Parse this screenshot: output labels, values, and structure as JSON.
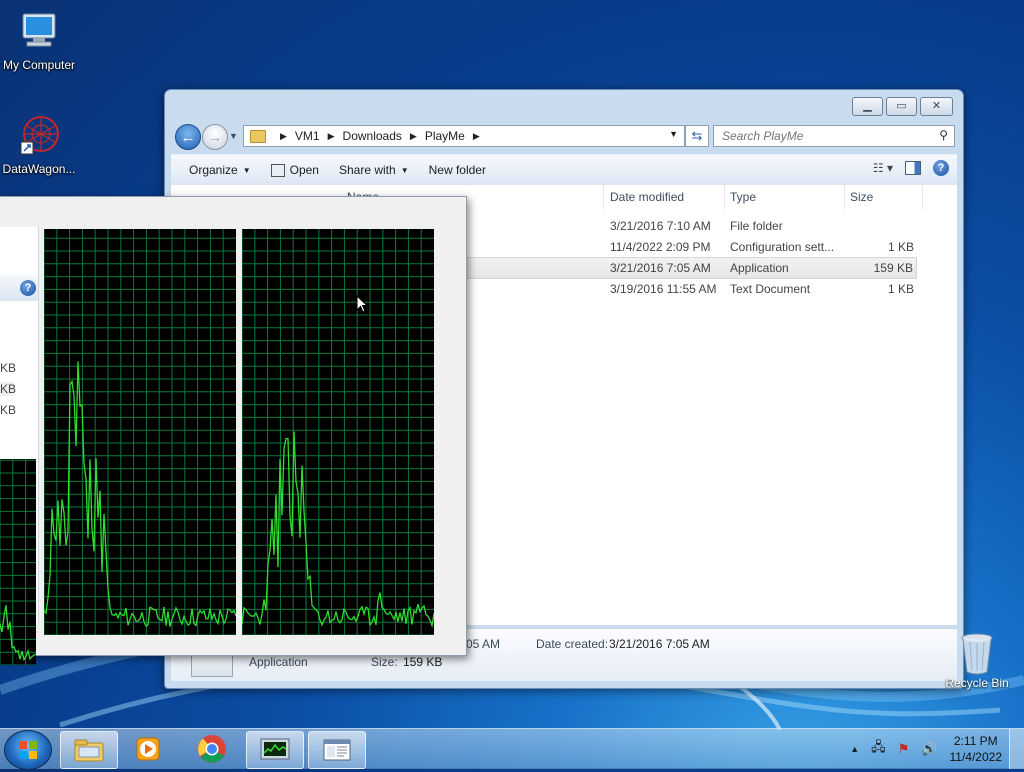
{
  "desktop": {
    "icons": [
      {
        "label": "My Computer",
        "icon": "computer-icon"
      },
      {
        "label": "DataWagon...",
        "icon": "datawagon-icon"
      },
      {
        "label": "Recycle Bin",
        "icon": "recycle-bin-icon"
      }
    ]
  },
  "explorer": {
    "breadcrumb": [
      "VM1",
      "Downloads",
      "PlayMe"
    ],
    "search_placeholder": "Search PlayMe",
    "toolbar": {
      "organize": "Organize",
      "open": "Open",
      "share_with": "Share with",
      "new_folder": "New folder"
    },
    "columns": {
      "name": "Name",
      "date_modified": "Date modified",
      "type": "Type",
      "size": "Size"
    },
    "files": [
      {
        "date": "3/21/2016 7:10 AM",
        "type": "File folder",
        "size": ""
      },
      {
        "date": "11/4/2022 2:09 PM",
        "type": "Configuration sett...",
        "size": "1 KB"
      },
      {
        "date": "3/21/2016 7:05 AM",
        "type": "Application",
        "size": "159 KB",
        "selected": true
      },
      {
        "date": "3/19/2016 11:55 AM",
        "type": "Text Document",
        "size": "1 KB"
      }
    ],
    "details": {
      "modified_fragment": "05 AM",
      "date_created_label": "Date created:",
      "date_created": "3/21/2016 7:05 AM",
      "type": "Application",
      "size_label": "Size:",
      "size": "159 KB"
    }
  },
  "perf_window": {
    "list_fragments": [
      "KB",
      "KB",
      "KB"
    ]
  },
  "taskbar": {
    "time": "2:11 PM",
    "date": "11/4/2022",
    "buttons": [
      "explorer-icon",
      "media-player-icon",
      "chrome-icon",
      "resource-monitor-icon",
      "window-icon"
    ]
  },
  "colors": {
    "graph_line": "#2fdc2f",
    "graph_grid": "#0d7a3a",
    "desktop_blue": "#0b4fa6"
  }
}
